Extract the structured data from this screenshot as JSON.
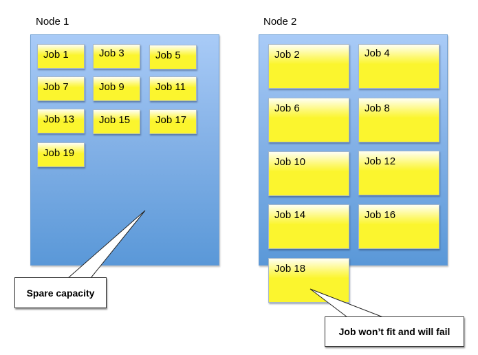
{
  "nodes": [
    {
      "label": "Node 1",
      "jobs": [
        "Job 1",
        "Job 3",
        "Job 5",
        "Job 7",
        "Job 9",
        "Job 11",
        "Job 13",
        "Job 15",
        "Job 17",
        "Job 19"
      ]
    },
    {
      "label": "Node 2",
      "jobs": [
        "Job 2",
        "Job 4",
        "Job 6",
        "Job 8",
        "Job 10",
        "Job 12",
        "Job 14",
        "Job 16"
      ]
    }
  ],
  "overflow_job": "Job 18",
  "callouts": {
    "spare": "Spare capacity",
    "fail": "Job won’t fit and will fail"
  },
  "colors": {
    "node_fill": "#85b2e7",
    "job_fill": "#fbf52e",
    "callout_fill": "#ffffff"
  }
}
